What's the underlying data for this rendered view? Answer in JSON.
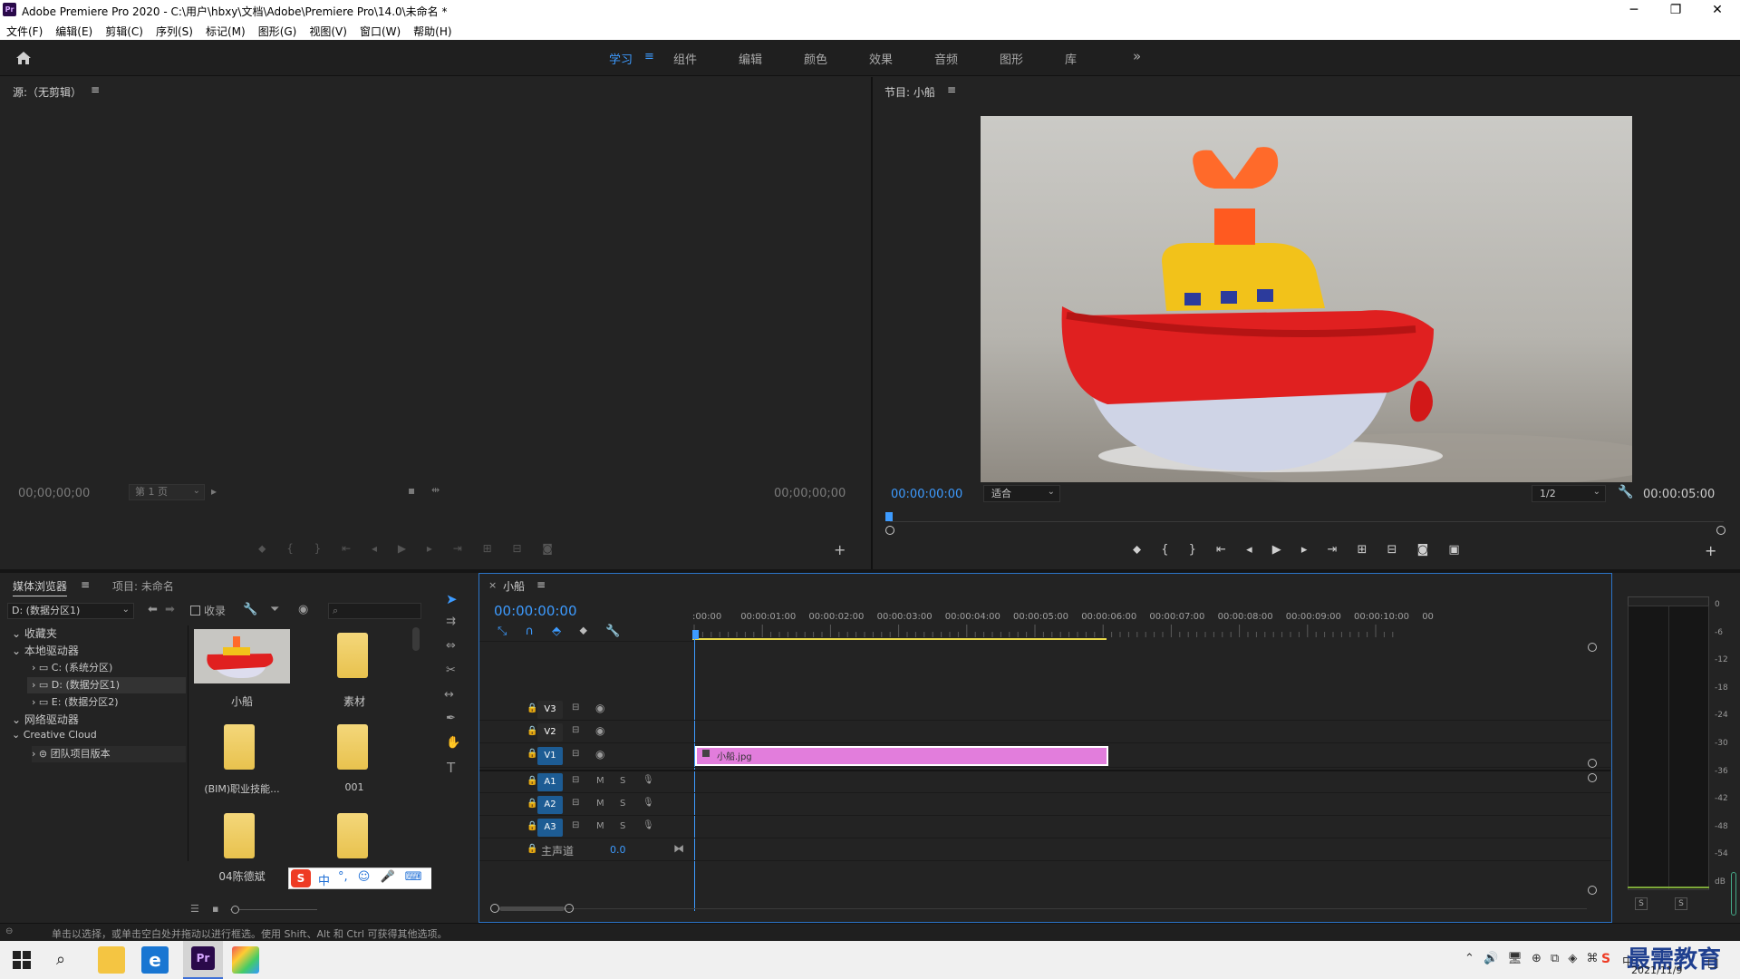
{
  "window": {
    "title": "Adobe Premiere Pro 2020 - C:\\用户\\hbxy\\文档\\Adobe\\Premiere Pro\\14.0\\未命名 *",
    "app_badge": "Pr",
    "minimize": "─",
    "maximize": "❐",
    "close": "✕"
  },
  "menu": [
    "文件(F)",
    "编辑(E)",
    "剪辑(C)",
    "序列(S)",
    "标记(M)",
    "图形(G)",
    "视图(V)",
    "窗口(W)",
    "帮助(H)"
  ],
  "workspaces": {
    "tabs": [
      "学习",
      "组件",
      "编辑",
      "颜色",
      "效果",
      "音频",
      "图形",
      "库"
    ],
    "active": "学习",
    "more": "»"
  },
  "source_monitor": {
    "title": "源:（无剪辑）",
    "timecode_in": "00;00;00;00",
    "page_select": "第 1 页",
    "timecode_out": "00;00;00;00"
  },
  "program_monitor": {
    "title": "节目: 小船",
    "timecode": "00:00:00:00",
    "fit": "适合",
    "resolution": "1/2",
    "duration": "00:00:05:00"
  },
  "project": {
    "tab_media_browser": "媒体浏览器",
    "tab_project": "项目: 未命名",
    "drive_select": "D: (数据分区1)",
    "ingest_label": "收录",
    "tree": [
      {
        "label": "收藏夹",
        "level": 0
      },
      {
        "label": "本地驱动器",
        "level": 0
      },
      {
        "label": "C: (系统分区)",
        "level": 1
      },
      {
        "label": "D: (数据分区1)",
        "level": 1
      },
      {
        "label": "E: (数据分区2)",
        "level": 1
      },
      {
        "label": "网络驱动器",
        "level": 0
      },
      {
        "label": "Creative Cloud",
        "level": 0
      },
      {
        "label": "团队项目版本",
        "level": 1
      }
    ],
    "items": [
      "小船",
      "素材",
      "(BIM)职业技能...",
      "001",
      "04陈德斌",
      ""
    ]
  },
  "timeline": {
    "sequence_name": "小船",
    "timecode": "00:00:00:00",
    "ruler": [
      ":00:00",
      "00:00:01:00",
      "00:00:02:00",
      "00:00:03:00",
      "00:00:04:00",
      "00:00:05:00",
      "00:00:06:00",
      "00:00:07:00",
      "00:00:08:00",
      "00:00:09:00",
      "00:00:10:00",
      "00"
    ],
    "video_tracks": [
      "V3",
      "V2",
      "V1"
    ],
    "audio_tracks": [
      "A1",
      "A2",
      "A3"
    ],
    "mute_label": "M",
    "solo_label": "S",
    "master_label": "主声道",
    "master_value": "0.0",
    "clip_name": "小船.jpg"
  },
  "meter": {
    "scale": [
      "0",
      "-6",
      "-12",
      "-18",
      "-24",
      "-30",
      "-36",
      "-42",
      "-48",
      "-54",
      "dB"
    ],
    "solo_left": "S",
    "solo_right": "S"
  },
  "ime": {
    "mode": "中"
  },
  "status": "单击以选择，或单击空白处并拖动以进行框选。使用 Shift、Alt 和 Ctrl 可获得其他选项。",
  "taskbar": {
    "watermark": "最需教育",
    "date": "2021/11/9",
    "lang": "中"
  }
}
